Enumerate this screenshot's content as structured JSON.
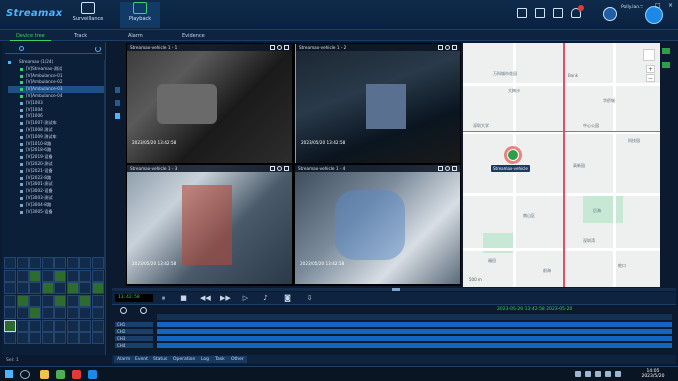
{
  "app": {
    "logo": "Streamax",
    "nav": [
      {
        "label": "Surveillance",
        "icon": "eye-icon"
      },
      {
        "label": "Playback",
        "icon": "play-icon"
      }
    ],
    "user": {
      "name": "Polly.lan...",
      "badge": "STREAMAX"
    },
    "window_controls": [
      "–",
      "□",
      "×"
    ]
  },
  "tabs": [
    "Device tree",
    "Track",
    "Alarm",
    "Evidence"
  ],
  "sidebar": {
    "root_label": "Streamax (1/24)",
    "items": [
      "[V]Streamax-测试",
      "[V]Ambulance-01",
      "[V]Ambulance-02",
      "[V]Ambulance-03",
      "[V]Ambulance-04",
      "[V]1003",
      "[V]1004",
      "[V]1006",
      "[V]1007-测试车",
      "[V]1008 测试",
      "[V]1009 测试车",
      "[V]1010-8路",
      "[V]2018-6路",
      "[V]2019-设备",
      "[V]2020-测试",
      "[V]2021-设备",
      "[V]2022-8路",
      "[V]3001-测试",
      "[V]3002-设备",
      "[V]3003-测试",
      "[V]3004-8路",
      "[V]3005-设备"
    ],
    "selected_index": 3,
    "footer": "Sel: 1"
  },
  "videos": [
    {
      "title": "Streamax-vehicle 1 - 1",
      "timestamp": "2023/05/20 13:42:58"
    },
    {
      "title": "Streamax-vehicle 1 - 2",
      "timestamp": "2023/05/20 13:42:58"
    },
    {
      "title": "Streamax-vehicle 1 - 3",
      "timestamp": "2023/05/20 13:42:58"
    },
    {
      "title": "Streamax-vehicle 1 - 4",
      "timestamp": "2023/05/20 13:42:58"
    }
  ],
  "map": {
    "marker_label": "Streamax-vehicle",
    "pois": [
      "万科城市花园",
      "大梅沙",
      "Bank",
      "华侨城",
      "深圳大学",
      "中心公园",
      "科技园",
      "高新园",
      "南山区",
      "后海",
      "福田",
      "深圳湾",
      "蛇口",
      "前海"
    ],
    "scale": "500 m"
  },
  "control": {
    "time": "13:42:58",
    "buttons": [
      "pause",
      "stop",
      "rewind",
      "fast-forward",
      "step",
      "volume",
      "snapshot",
      "download"
    ]
  },
  "timeline": {
    "date": "2023-05-20 13:42:58 2023-05-20",
    "rows": [
      "CH1",
      "CH2",
      "CH3",
      "CH4"
    ]
  },
  "bottom_tabs": [
    "Alarm",
    "Event",
    "Status",
    "Operation",
    "Log",
    "Task",
    "Other"
  ],
  "taskbar": {
    "clock_time": "14:05",
    "clock_date": "2023/5/20"
  }
}
